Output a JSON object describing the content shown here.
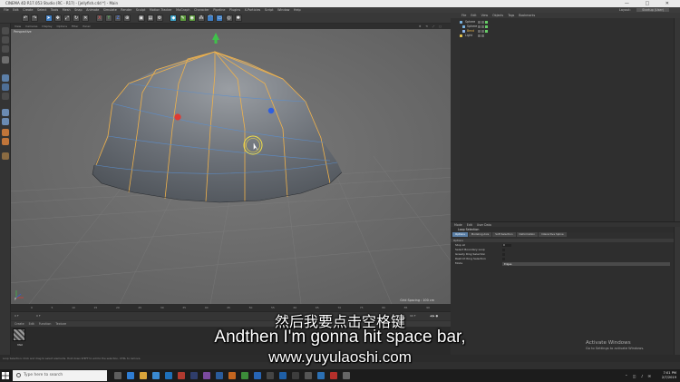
{
  "window": {
    "title": "CINEMA 4D R17.053 Studio (RC - R17) - [jellyfish.c4d *] - Main",
    "controls": [
      "—",
      "□",
      "✕"
    ]
  },
  "menubar": {
    "items": [
      "File",
      "Edit",
      "Create",
      "Select",
      "Tools",
      "Mesh",
      "Snap",
      "Animate",
      "Simulate",
      "Render",
      "Sculpt",
      "Motion Tracker",
      "MoGraph",
      "Character",
      "Pipeline",
      "Plugins",
      "X-Particles",
      "Script",
      "Window",
      "Help"
    ],
    "layout_label": "Layout:",
    "layout_value": "Startup (User)"
  },
  "viewport": {
    "menu": [
      "View",
      "Cameras",
      "Display",
      "Options",
      "Filter",
      "Panel"
    ],
    "label": "Perspective",
    "grid_spacing": "Grid Spacing : 100 cm",
    "axis_label": "y"
  },
  "timeline": {
    "ticks": [
      "0",
      "5",
      "10",
      "15",
      "20",
      "25",
      "30",
      "35",
      "40",
      "45",
      "50",
      "55",
      "60",
      "65",
      "70",
      "75",
      "80",
      "85",
      "90"
    ],
    "start_frame": "0 F",
    "end_frame": "90 F",
    "current_frame": "0 F"
  },
  "material_manager": {
    "menu": [
      "Create",
      "Edit",
      "Function",
      "Texture"
    ],
    "materials": [
      {
        "name": "Mat"
      }
    ]
  },
  "object_manager": {
    "menu": [
      "File",
      "Edit",
      "View",
      "Objects",
      "Tags",
      "Bookmarks"
    ],
    "objects": [
      {
        "name": "Sphere",
        "selected": false
      },
      {
        "name": "Sphere",
        "selected": false
      },
      {
        "name": "Bend",
        "selected": true
      },
      {
        "name": "Light",
        "selected": false
      }
    ]
  },
  "attribute_manager": {
    "menu": [
      "Mode",
      "Edit",
      "User Data"
    ],
    "title": "Loop Selection",
    "tabs": [
      {
        "label": "Options",
        "active": true
      },
      {
        "label": "Modeling Axis",
        "active": false
      },
      {
        "label": "Soft Selection",
        "active": false
      },
      {
        "label": "Deformation",
        "active": false
      },
      {
        "label": "Interactive Spline",
        "active": false
      }
    ],
    "section": "Options",
    "rows": [
      {
        "label": "Stop at",
        "kind": "value",
        "value": "0"
      },
      {
        "label": "Select Boundary Loop",
        "kind": "check"
      },
      {
        "label": "Greedy Ring Selection",
        "kind": "check"
      },
      {
        "label": "Restrict Ring Selection",
        "kind": "check"
      },
      {
        "label": "Mode",
        "kind": "dropdown",
        "value": "Edges"
      }
    ]
  },
  "subtitles": {
    "chinese": "然后我要点击空格键",
    "english": "Andthen I'm gonna hit space bar,",
    "website": "www.yuyulaoshi.com"
  },
  "statusbar": {
    "text": "Loop Selection: Click and drag to select elements. Hold down SHIFT to add to the selection, CTRL to remove."
  },
  "watermark": {
    "title": "Activate Windows",
    "subtitle": "Go to Settings to activate Windows."
  },
  "taskbar": {
    "search_placeholder": "Type here to search",
    "time": "7:01 PM",
    "date": "2/7/2019"
  },
  "colors": {
    "viewport_bg": "#6d6d6d",
    "mesh_edge": "#f0b24b",
    "selection_ring": "#f2e046",
    "toolbar_blue": "#3f7ec4"
  }
}
